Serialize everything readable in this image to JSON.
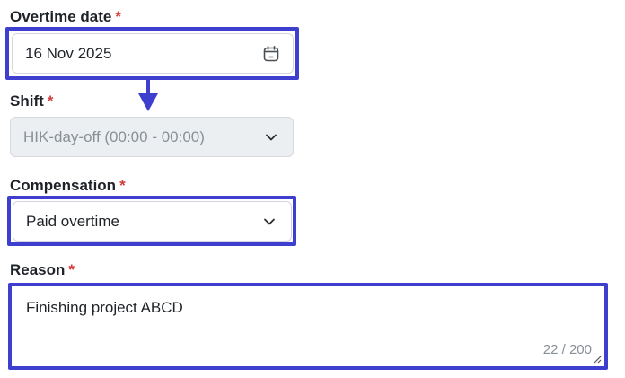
{
  "form": {
    "overtime_date": {
      "label": "Overtime date",
      "required_mark": "*",
      "value": "16 Nov 2025",
      "icon": "calendar-icon"
    },
    "shift": {
      "label": "Shift",
      "required_mark": "*",
      "value": "HIK-day-off (00:00 - 00:00)",
      "icon": "chevron-down-icon",
      "disabled": true
    },
    "compensation": {
      "label": "Compensation",
      "required_mark": "*",
      "value": "Paid overtime",
      "icon": "chevron-down-icon"
    },
    "reason": {
      "label": "Reason",
      "required_mark": "*",
      "value": "Finishing project ABCD",
      "counter": "22 / 200"
    }
  },
  "colors": {
    "highlight": "#3f3fcf",
    "required": "#d23b3b",
    "disabled_bg": "#eceff2"
  }
}
